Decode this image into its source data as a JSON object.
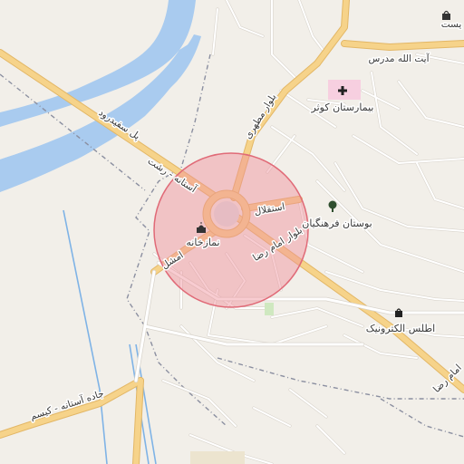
{
  "map": {
    "colors": {
      "land": "#f2efe9",
      "water": "#a9cbef",
      "major_road": "#f6d38a",
      "major_road_casing": "#e3b766",
      "minor_road": "#ffffff",
      "minor_road_casing": "#d9d4cc",
      "boundary": "#8b8fa0",
      "canal": "#7fb3e6",
      "highlight_fill": "#f08e98",
      "highlight_stroke": "#e06a77",
      "hospital": "#f7cfe0",
      "park": "#cfe8c0"
    },
    "roads": {
      "road_north_right": "آیت الله مدرس",
      "road_top_right": "یست",
      "road_motahari": "بلوار مطهری",
      "road_pol": "پل سفیدرود",
      "road_astane": "آستانه - رشت",
      "road_esteghlal": "استقلال",
      "road_imamreza": "بلوار امام رضا",
      "road_imamreza2": "امام رضا",
      "road_amshal": "امشل",
      "road_kisom": "جاده آستانه - کیسم"
    },
    "pois": {
      "hospital": "بیمارستان کوثر",
      "park": "بوستان فرهنگیان",
      "prayer": "نمازخانه",
      "shop": "اطلس الکترونیک"
    },
    "icons": {
      "hospital": "hospital-cross-icon",
      "park": "tree-icon",
      "prayer": "mosque-icon",
      "shop": "shopping-bag-icon",
      "top": "bag-icon"
    },
    "highlight": {
      "label": ""
    }
  }
}
